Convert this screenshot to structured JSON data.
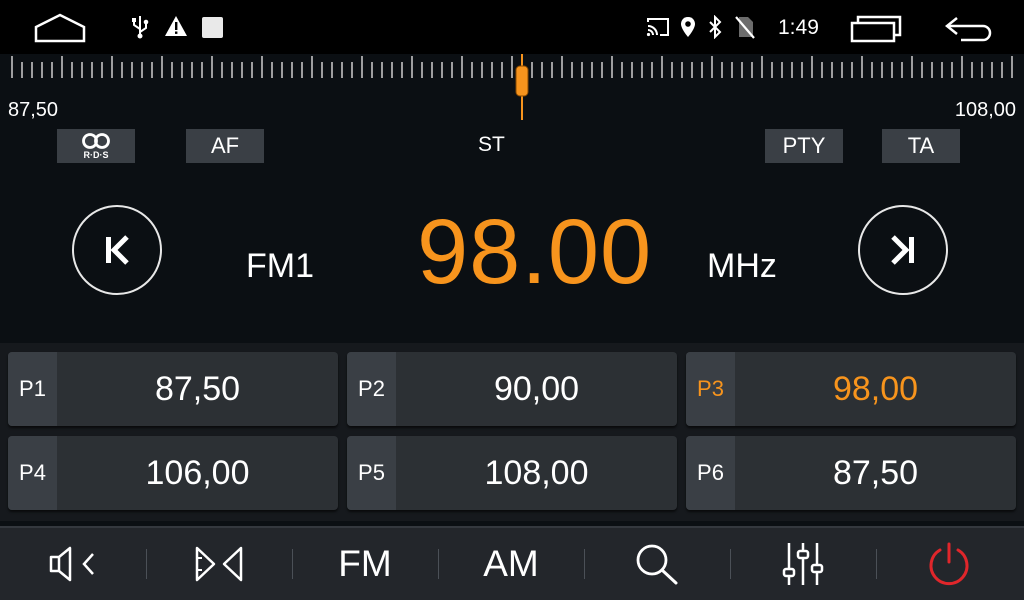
{
  "status_bar": {
    "time": "1:49",
    "left_icons": [
      "home-icon",
      "usb-icon",
      "warning-icon",
      "notification-square-icon"
    ],
    "right_icons": [
      "cast-icon",
      "location-icon",
      "bluetooth-icon",
      "no-sim-icon",
      "recent-apps-icon",
      "back-icon"
    ]
  },
  "tuner": {
    "scale_min": "87,50",
    "scale_max": "108,00",
    "needle_position": 0.51,
    "indicators": {
      "rds_label": "R·D·S",
      "af": "AF",
      "st": "ST",
      "pty": "PTY",
      "ta": "TA"
    },
    "band": "FM1",
    "frequency": "98.00",
    "unit": "MHz"
  },
  "presets": [
    {
      "tag": "P1",
      "value": "87,50",
      "active": false
    },
    {
      "tag": "P2",
      "value": "90,00",
      "active": false
    },
    {
      "tag": "P3",
      "value": "98,00",
      "active": true
    },
    {
      "tag": "P4",
      "value": "106,00",
      "active": false
    },
    {
      "tag": "P5",
      "value": "108,00",
      "active": false
    },
    {
      "tag": "P6",
      "value": "87,50",
      "active": false
    }
  ],
  "bottom_bar": {
    "fm": "FM",
    "am": "AM",
    "icons": [
      "volume-icon",
      "speaker-balance-icon",
      "search-icon",
      "equalizer-icon",
      "power-icon"
    ]
  },
  "colors": {
    "accent": "#f7941d",
    "power": "#e0262b",
    "background": "#0b0f13",
    "preset_bg": "#2c3034"
  }
}
